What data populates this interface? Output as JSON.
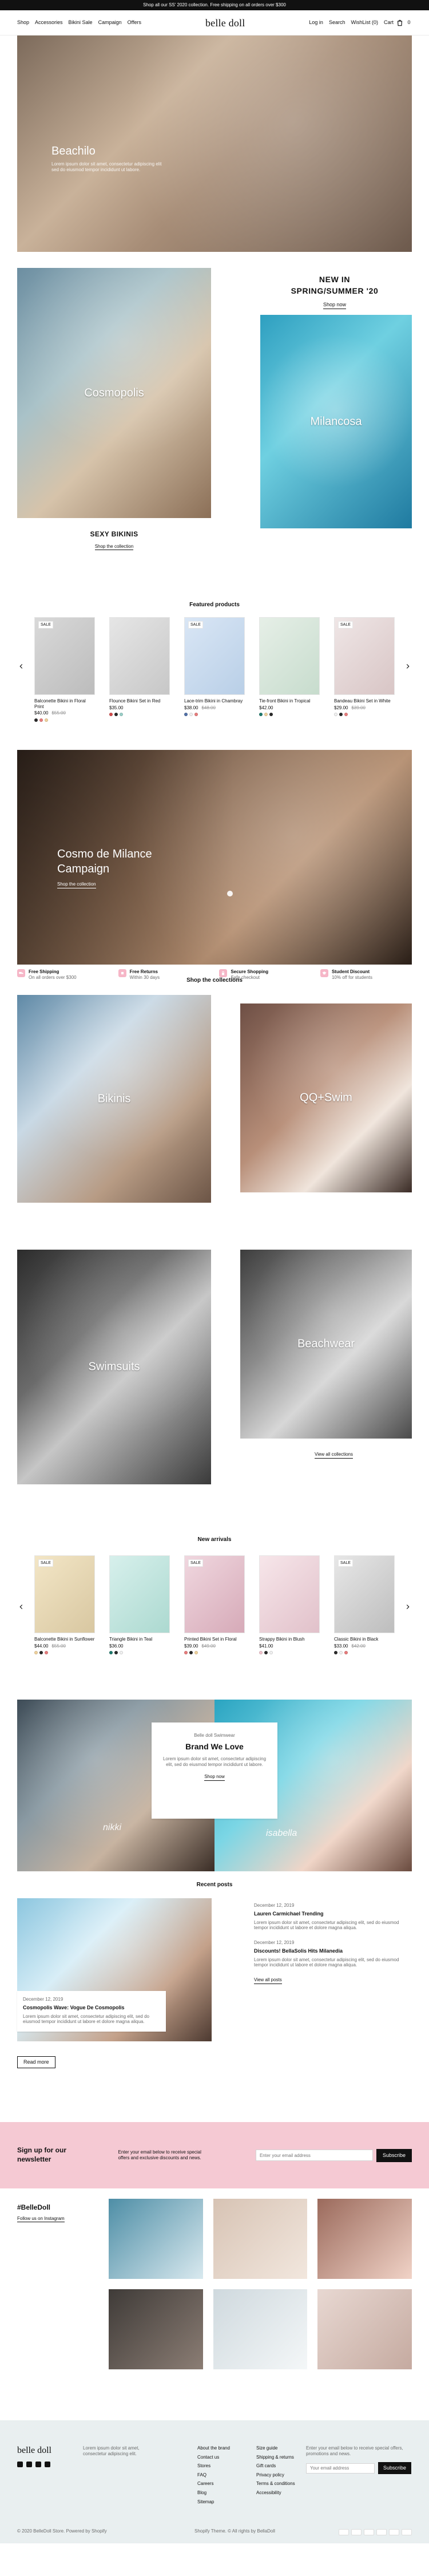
{
  "promo_bar": {
    "text": "Shop all our SS' 2020 collection. Free shipping on all orders over $300"
  },
  "header": {
    "left_nav": [
      {
        "label": "Shop"
      },
      {
        "label": "Accessories"
      },
      {
        "label": "Bikini Sale"
      },
      {
        "label": "Campaign"
      },
      {
        "label": "Offers"
      }
    ],
    "logo": "belle doll",
    "right_nav": [
      {
        "label": "Log in"
      },
      {
        "label": "Search"
      },
      {
        "label": "WishList (0)"
      },
      {
        "label": "Cart"
      }
    ],
    "cart_count": "0"
  },
  "hero": {
    "title": "Beachilo",
    "subtitle_lines": [
      "Lorem ipsum dolor sit amet, consectetur adipiscing elit",
      "sed do eiusmod tempor incididunt ut labore."
    ]
  },
  "new_in": {
    "title_line1": "NEW IN",
    "title_line2": "SPRING/SUMMER '20",
    "cta": "Shop now",
    "left_image_label": "Cosmopolis",
    "right_image_label": "Milancosa",
    "left_caption_title": "SEXY BIKINIS",
    "left_caption_link": "Shop the collection"
  },
  "featured": {
    "title": "Featured products",
    "products": [
      {
        "badge": "SALE",
        "name": "Balconette Bikini in Floral Print",
        "price": "$40.00",
        "old_price": "$55.00",
        "swatches": [
          "#2a2a2a",
          "#e97d7d",
          "#f1d39e"
        ]
      },
      {
        "badge": "",
        "name": "Flounce Bikini Set in Red",
        "price": "$35.00",
        "old_price": "",
        "swatches": [
          "#d44b4b",
          "#2a2a2a",
          "#9ad0c9"
        ]
      },
      {
        "badge": "SALE",
        "name": "Lace-trim Bikini in Chambray",
        "price": "$38.00",
        "old_price": "$48.00",
        "swatches": [
          "#5271a8",
          "#f2f2f2",
          "#e97d7d"
        ]
      },
      {
        "badge": "",
        "name": "Tie-front Bikini in Tropical",
        "price": "$42.00",
        "old_price": "",
        "swatches": [
          "#1f7a6d",
          "#f1d39e",
          "#2a2a2a"
        ]
      },
      {
        "badge": "SALE",
        "name": "Bandeau Bikini Set in White",
        "price": "$29.00",
        "old_price": "$39.00",
        "swatches": [
          "#f2f2f2",
          "#2a2a2a",
          "#e97d7d"
        ]
      }
    ]
  },
  "campaign": {
    "title_line1": "Cosmo de Milance",
    "title_line2": "Campaign",
    "link": "Shop the collection"
  },
  "features_row": [
    {
      "title": "Free Shipping",
      "subtitle": "On all orders over $300"
    },
    {
      "title": "Free Returns",
      "subtitle": "Within 30 days"
    },
    {
      "title": "Secure Shopping",
      "subtitle": "Safe checkout"
    },
    {
      "title": "Student Discount",
      "subtitle": "10% off for students"
    }
  ],
  "collections": {
    "title": "Shop the collections",
    "cards": [
      {
        "label": "Bikinis"
      },
      {
        "label": "QQ+Swim"
      },
      {
        "label": "Swimsuits"
      },
      {
        "label": "Beachwear"
      }
    ],
    "all_link": "View all collections"
  },
  "new_arrivals": {
    "title": "New arrivals",
    "products": [
      {
        "badge": "SALE",
        "name": "Balconette Bikini in Sunflower",
        "price": "$44.00",
        "old_price": "$55.00",
        "swatches": [
          "#f1d39e",
          "#2a2a2a",
          "#e97d7d"
        ]
      },
      {
        "badge": "",
        "name": "Triangle Bikini in Teal",
        "price": "$36.00",
        "old_price": "",
        "swatches": [
          "#1f7a6d",
          "#2a2a2a",
          "#f2f2f2"
        ]
      },
      {
        "badge": "SALE",
        "name": "Printed Bikini Set in Floral",
        "price": "$39.00",
        "old_price": "$49.00",
        "swatches": [
          "#e97d7d",
          "#2a2a2a",
          "#f1d39e"
        ]
      },
      {
        "badge": "",
        "name": "Strappy Bikini in Blush",
        "price": "$41.00",
        "old_price": "",
        "swatches": [
          "#f3c6cf",
          "#2a2a2a",
          "#f2f2f2"
        ]
      },
      {
        "badge": "SALE",
        "name": "Classic Bikini in Black",
        "price": "$33.00",
        "old_price": "$42.00",
        "swatches": [
          "#2a2a2a",
          "#f2f2f2",
          "#e97d7d"
        ]
      }
    ]
  },
  "brand": {
    "kicker": "Belle doll Swimwear",
    "title": "Brand We Love",
    "text": "Lorem ipsum dolor sit amet, consectetur adipiscing elit, sed do eiusmod tempor incididunt ut labore.",
    "button": "Shop now",
    "left_tag": "nikki",
    "right_tag": "isabella"
  },
  "recent_posts": {
    "title": "Recent posts",
    "left_post": {
      "date": "December 12, 2019",
      "title": "Cosmopolis Wave: Vogue De Cosmopolis",
      "excerpt": "Lorem ipsum dolor sit amet, consectetur adipiscing elit, sed do eiusmod tempor incididunt ut labore et dolore magna aliqua.",
      "button": "Read more"
    },
    "right_posts": [
      {
        "date": "December 12, 2019",
        "title": "Lauren Carmichael Trending",
        "excerpt": "Lorem ipsum dolor sit amet, consectetur adipiscing elit, sed do eiusmod tempor incididunt ut labore et dolore magna aliqua."
      },
      {
        "date": "December 12, 2019",
        "title": "Discounts! BellaSolis Hits Milanedia",
        "excerpt": "Lorem ipsum dolor sit amet, consectetur adipiscing elit, sed do eiusmod tempor incididunt ut labore et dolore magna aliqua."
      }
    ],
    "all_link": "View all posts"
  },
  "newsletter": {
    "title_line1": "Sign up for our",
    "title_line2": "newsletter",
    "text": "Enter your email below to receive special offers and exclusive discounts and news.",
    "placeholder": "Enter your email address",
    "button": "Subscribe"
  },
  "social_grid": {
    "title": "#BelleDoll",
    "subtitle": "Follow us on Instagram"
  },
  "footer": {
    "logo": "belle doll",
    "about": "Lorem ipsum dolor sit amet, consectetur adipiscing elit.",
    "cols": [
      {
        "items": [
          "About the brand",
          "Contact us",
          "Stores",
          "FAQ",
          "Careers",
          "Blog",
          "Sitemap"
        ]
      },
      {
        "items": [
          "Size guide",
          "Shipping & returns",
          "Gift cards",
          "Privacy policy",
          "Terms & conditions",
          "Accessibility"
        ]
      }
    ],
    "newsletter_text": "Enter your email below to receive special offers, promotions and news.",
    "newsletter_placeholder": "Your email address",
    "newsletter_button": "Subscribe",
    "copyright": "© 2020 BelleDoll Store. Powered by Shopify",
    "payment_note": "Shopify Theme. © All rights by BellaDoll"
  }
}
